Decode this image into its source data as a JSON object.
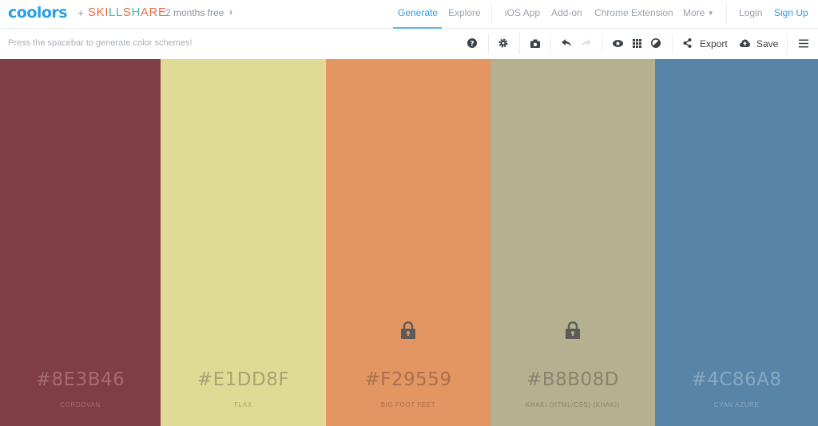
{
  "header": {
    "logo": "coolors",
    "plus": "+",
    "partner_logo": "SKILLSHARE",
    "promo": "2 months free",
    "promo_icon": "chevron-right-icon",
    "nav": {
      "generate": "Generate",
      "explore": "Explore",
      "ios_app": "iOS App",
      "addon": "Add-on",
      "chrome_extension": "Chrome Extension",
      "more": "More",
      "login": "Login",
      "signup": "Sign Up"
    },
    "active_tab": "Generate",
    "accent_color": "#2d9ee8"
  },
  "toolbar": {
    "hint": "Press the spacebar to generate color schemes!",
    "icons": [
      "help-icon",
      "settings-icon",
      "camera-icon",
      "undo-icon",
      "redo-icon",
      "view-icon",
      "grid-icon",
      "adjust-icon",
      "share-icon",
      "cloud-upload-icon",
      "menu-icon"
    ],
    "export_label": "Export",
    "save_label": "Save"
  },
  "palette": [
    {
      "hex": "#8E3B46",
      "name": "CORDOVAN",
      "bg": "#7f3d45",
      "text": "#a66b72",
      "locked": false
    },
    {
      "hex": "#E1DD8F",
      "name": "FLAX",
      "bg": "#dfdb95",
      "text": "#a6a470",
      "locked": false
    },
    {
      "hex": "#F29559",
      "name": "BIG FOOT FEET",
      "bg": "#e39562",
      "text": "#a97050",
      "locked": true
    },
    {
      "hex": "#B8B08D",
      "name": "KHAKI (HTML/CSS) (KHAKI)",
      "bg": "#b5b08f",
      "text": "#878470",
      "locked": true
    },
    {
      "hex": "#4C86A8",
      "name": "CYAN AZURE",
      "bg": "#5885a7",
      "text": "#88a8c2",
      "locked": false
    }
  ]
}
